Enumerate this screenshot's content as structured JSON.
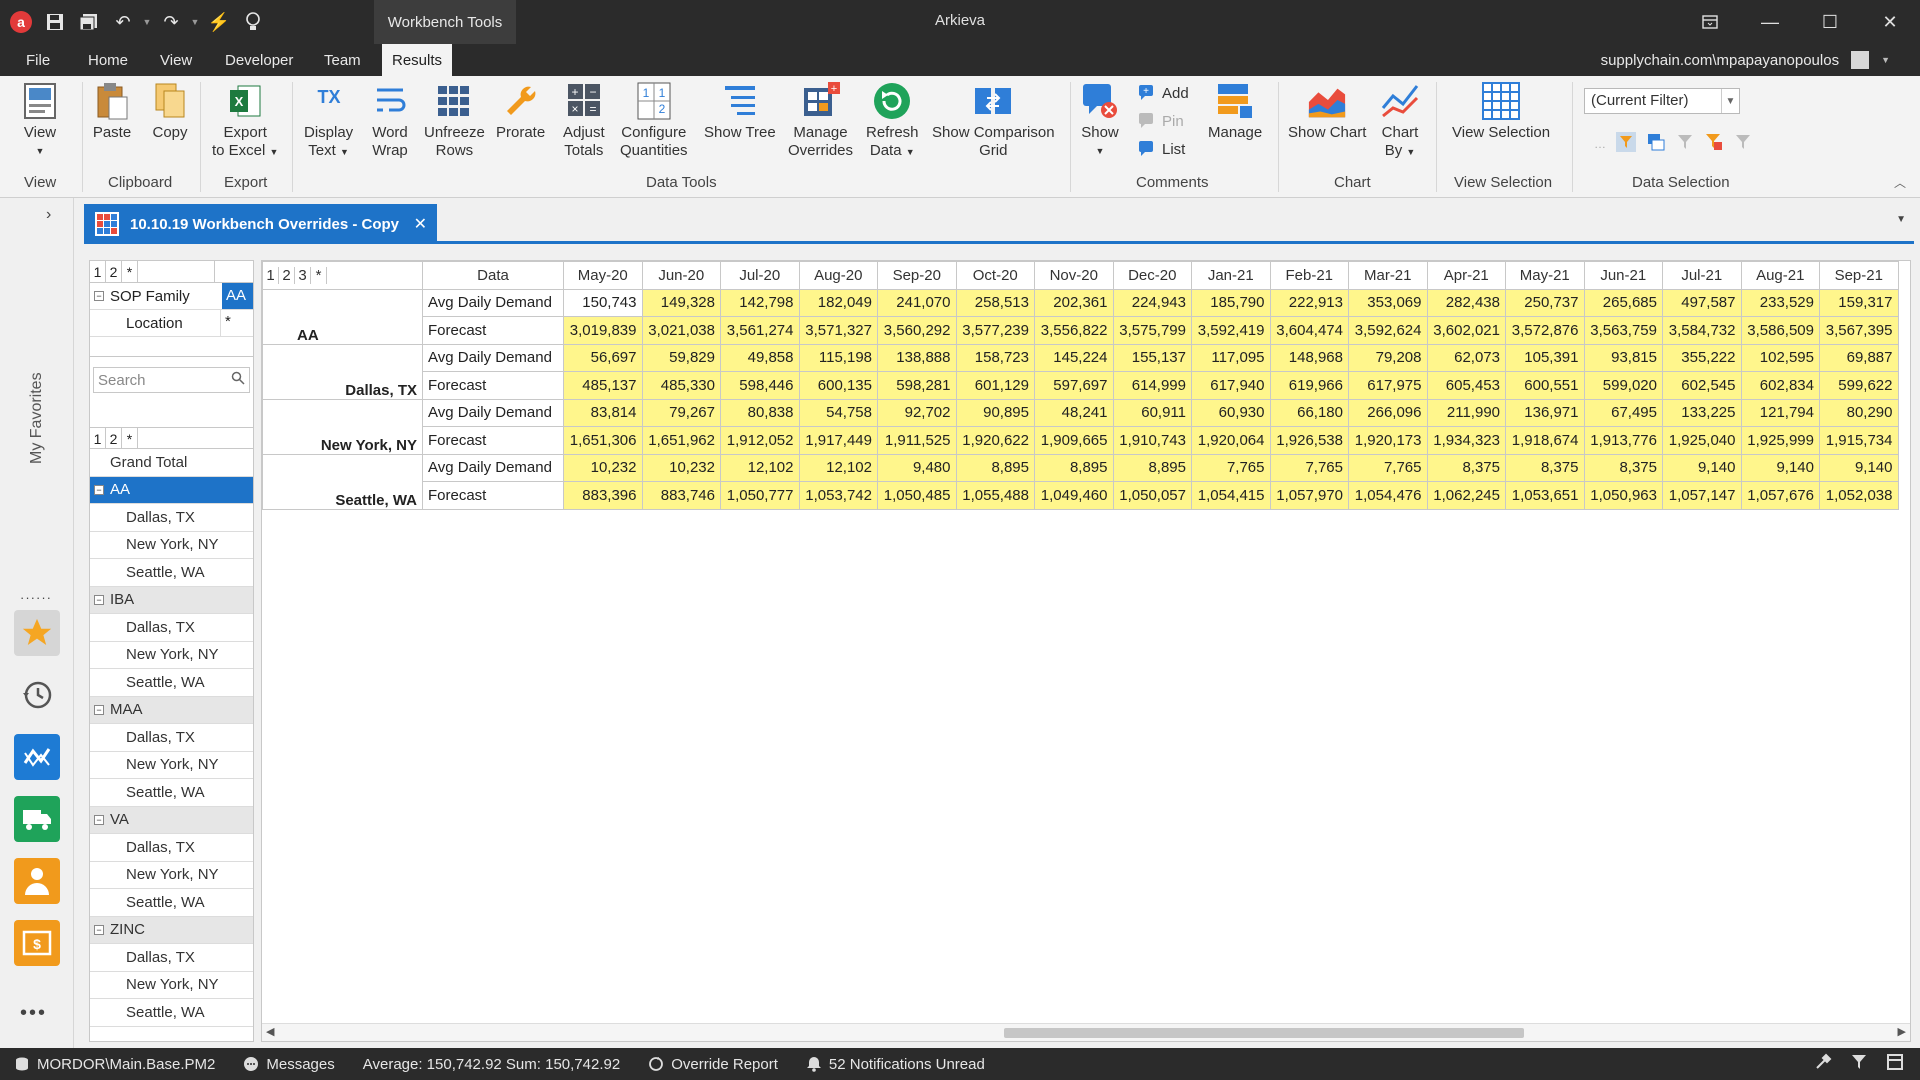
{
  "titlebar": {
    "app_title": "Arkieva",
    "context_tab": "Workbench Tools"
  },
  "menu": {
    "tabs": [
      "File",
      "Home",
      "View",
      "Developer",
      "Team",
      "Results"
    ],
    "active": "Results",
    "user": "supplychain.com\\mpapayanopoulos"
  },
  "ribbon": {
    "view": "View",
    "paste": "Paste",
    "copy": "Copy",
    "export_excel_1": "Export",
    "export_excel_2": "to Excel",
    "display_text_1": "Display",
    "display_text_2": "Text",
    "word_wrap_1": "Word",
    "word_wrap_2": "Wrap",
    "unfreeze_1": "Unfreeze",
    "unfreeze_2": "Rows",
    "prorate": "Prorate",
    "adjust_1": "Adjust",
    "adjust_2": "Totals",
    "configure_1": "Configure",
    "configure_2": "Quantities",
    "show_tree": "Show Tree",
    "manage_overrides_1": "Manage",
    "manage_overrides_2": "Overrides",
    "refresh_1": "Refresh",
    "refresh_2": "Data",
    "comparison_1": "Show Comparison",
    "comparison_2": "Grid",
    "show": "Show",
    "add": "Add",
    "pin": "Pin",
    "list": "List",
    "manage": "Manage",
    "show_chart": "Show Chart",
    "chart_by_1": "Chart",
    "chart_by_2": "By",
    "view_selection": "View Selection",
    "current_filter": "(Current Filter)",
    "groups": {
      "view": "View",
      "clipboard": "Clipboard",
      "export": "Export",
      "data_tools": "Data Tools",
      "comments": "Comments",
      "chart": "Chart",
      "view_selection": "View Selection",
      "data_selection": "Data Selection"
    }
  },
  "document_tab": "10.10.19 Workbench Overrides - Copy",
  "left_rail": {
    "label": "My Favorites"
  },
  "filter_pane": {
    "levels": [
      "1",
      "2",
      "*"
    ],
    "fields": [
      {
        "name": "SOP Family",
        "value": "AA"
      },
      {
        "name": "Location",
        "value": "*"
      }
    ],
    "search_placeholder": "Search",
    "tree_levels": [
      "1",
      "2",
      "*"
    ],
    "tree": [
      {
        "label": "Grand Total",
        "type": "total"
      },
      {
        "label": "AA",
        "type": "group",
        "selected": true
      },
      {
        "label": "Dallas, TX",
        "type": "child"
      },
      {
        "label": "New York, NY",
        "type": "child"
      },
      {
        "label": "Seattle, WA",
        "type": "child"
      },
      {
        "label": "IBA",
        "type": "group"
      },
      {
        "label": "Dallas, TX",
        "type": "child"
      },
      {
        "label": "New York, NY",
        "type": "child"
      },
      {
        "label": "Seattle, WA",
        "type": "child"
      },
      {
        "label": "MAA",
        "type": "group"
      },
      {
        "label": "Dallas, TX",
        "type": "child"
      },
      {
        "label": "New York, NY",
        "type": "child"
      },
      {
        "label": "Seattle, WA",
        "type": "child"
      },
      {
        "label": "VA",
        "type": "group"
      },
      {
        "label": "Dallas, TX",
        "type": "child"
      },
      {
        "label": "New York, NY",
        "type": "child"
      },
      {
        "label": "Seattle, WA",
        "type": "child"
      },
      {
        "label": "ZINC",
        "type": "group"
      },
      {
        "label": "Dallas, TX",
        "type": "child"
      },
      {
        "label": "New York, NY",
        "type": "child"
      },
      {
        "label": "Seattle, WA",
        "type": "child"
      }
    ]
  },
  "grid": {
    "levels": [
      "1",
      "2",
      "3",
      "*"
    ],
    "data_header": "Data",
    "months": [
      "May-20",
      "Jun-20",
      "Jul-20",
      "Aug-20",
      "Sep-20",
      "Oct-20",
      "Nov-20",
      "Dec-20",
      "Jan-21",
      "Feb-21",
      "Mar-21",
      "Apr-21",
      "May-21",
      "Jun-21",
      "Jul-21",
      "Aug-21",
      "Sep-21"
    ],
    "groups": [
      {
        "location": "AA",
        "rows": [
          {
            "measure": "Avg Daily Demand",
            "values": [
              "150,743",
              "149,328",
              "142,798",
              "182,049",
              "241,070",
              "258,513",
              "202,361",
              "224,943",
              "185,790",
              "222,913",
              "353,069",
              "282,438",
              "250,737",
              "265,685",
              "497,587",
              "233,529",
              "159,317"
            ]
          },
          {
            "measure": "Forecast",
            "values": [
              "3,019,839",
              "3,021,038",
              "3,561,274",
              "3,571,327",
              "3,560,292",
              "3,577,239",
              "3,556,822",
              "3,575,799",
              "3,592,419",
              "3,604,474",
              "3,592,624",
              "3,602,021",
              "3,572,876",
              "3,563,759",
              "3,584,732",
              "3,586,509",
              "3,567,395"
            ]
          }
        ]
      },
      {
        "location": "Dallas, TX",
        "rows": [
          {
            "measure": "Avg Daily Demand",
            "values": [
              "56,697",
              "59,829",
              "49,858",
              "115,198",
              "138,888",
              "158,723",
              "145,224",
              "155,137",
              "117,095",
              "148,968",
              "79,208",
              "62,073",
              "105,391",
              "93,815",
              "355,222",
              "102,595",
              "69,887"
            ]
          },
          {
            "measure": "Forecast",
            "values": [
              "485,137",
              "485,330",
              "598,446",
              "600,135",
              "598,281",
              "601,129",
              "597,697",
              "614,999",
              "617,940",
              "619,966",
              "617,975",
              "605,453",
              "600,551",
              "599,020",
              "602,545",
              "602,834",
              "599,622"
            ]
          }
        ]
      },
      {
        "location": "New York, NY",
        "rows": [
          {
            "measure": "Avg Daily Demand",
            "values": [
              "83,814",
              "79,267",
              "80,838",
              "54,758",
              "92,702",
              "90,895",
              "48,241",
              "60,911",
              "60,930",
              "66,180",
              "266,096",
              "211,990",
              "136,971",
              "67,495",
              "133,225",
              "121,794",
              "80,290"
            ]
          },
          {
            "measure": "Forecast",
            "values": [
              "1,651,306",
              "1,651,962",
              "1,912,052",
              "1,917,449",
              "1,911,525",
              "1,920,622",
              "1,909,665",
              "1,910,743",
              "1,920,064",
              "1,926,538",
              "1,920,173",
              "1,934,323",
              "1,918,674",
              "1,913,776",
              "1,925,040",
              "1,925,999",
              "1,915,734"
            ]
          }
        ]
      },
      {
        "location": "Seattle, WA",
        "rows": [
          {
            "measure": "Avg Daily Demand",
            "values": [
              "10,232",
              "10,232",
              "12,102",
              "12,102",
              "9,480",
              "8,895",
              "8,895",
              "8,895",
              "7,765",
              "7,765",
              "7,765",
              "8,375",
              "8,375",
              "8,375",
              "9,140",
              "9,140",
              "9,140"
            ]
          },
          {
            "measure": "Forecast",
            "values": [
              "883,396",
              "883,746",
              "1,050,777",
              "1,053,742",
              "1,050,485",
              "1,055,488",
              "1,049,460",
              "1,050,057",
              "1,054,415",
              "1,057,970",
              "1,054,476",
              "1,062,245",
              "1,053,651",
              "1,050,963",
              "1,057,147",
              "1,057,676",
              "1,052,038"
            ]
          }
        ]
      }
    ]
  },
  "statusbar": {
    "model": "MORDOR\\Main.Base.PM2",
    "messages": "Messages",
    "stats": "Average: 150,742.92 Sum: 150,742.92",
    "report": "Override Report",
    "notifications": "52 Notifications Unread"
  },
  "colors": {
    "accent": "#1e73c8",
    "cell_highlight": "#fff68c",
    "chrome": "#2b2b2b"
  }
}
